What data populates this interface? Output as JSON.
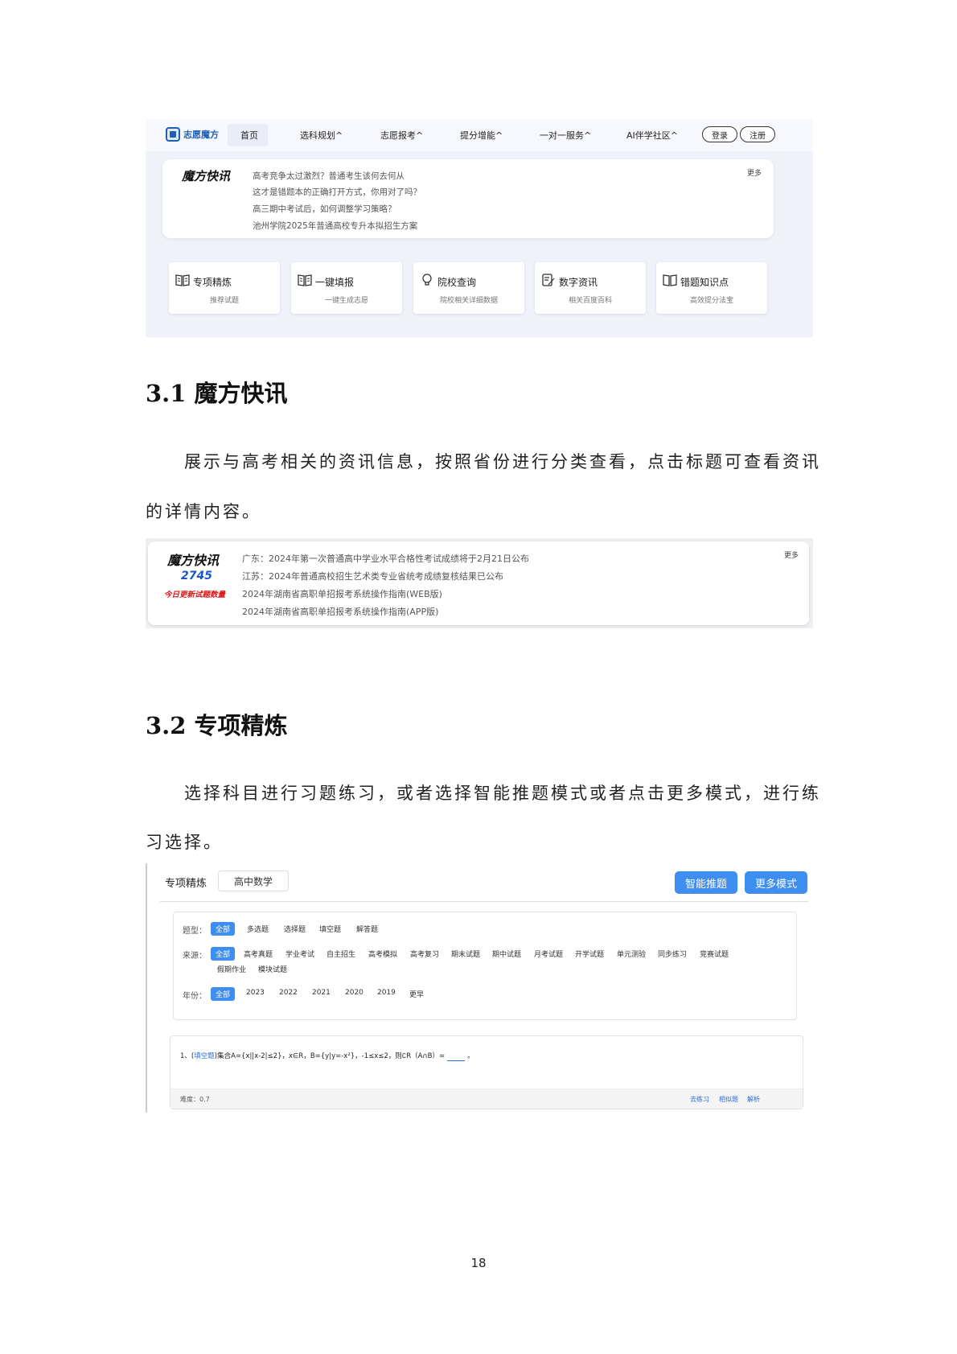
{
  "shot1": {
    "logo_text": "志愿魔方",
    "nav": [
      "首页",
      "选科规划",
      "志愿报考",
      "提分增能",
      "一对一服务",
      "AI伴学社区"
    ],
    "login": "登录",
    "register": "注册",
    "news_brand": "魔方快讯",
    "more": "更多",
    "news": [
      "高考竞争太过激烈？普通考生该何去何从",
      "这才是错题本的正确打开方式，你用对了吗？",
      "高三期中考试后，如何调整学习策略？",
      "池州学院2025年普通高校专升本拟招生方案"
    ],
    "features": [
      {
        "title": "专项精炼",
        "sub": "推荐试题"
      },
      {
        "title": "一键填报",
        "sub": "一键生成志愿"
      },
      {
        "title": "院校查询",
        "sub": "院校相关详细数据"
      },
      {
        "title": "数字资讯",
        "sub": "相关百度百科"
      },
      {
        "title": "错题知识点",
        "sub": "高效提分法宝"
      }
    ]
  },
  "section1": {
    "heading": "3.1  魔方快讯",
    "para_line1": "展示与高考相关的资讯信息，按照省份进行分类查看，点击标题可查看资讯",
    "para_line2": "的详情内容。"
  },
  "shot2": {
    "brand": "魔方快讯",
    "count": "2745",
    "count_label": "今日更新试题数量",
    "more": "更多",
    "news": [
      "广东：2024年第一次普通高中学业水平合格性考试成绩将于2月21日公布",
      "江苏：2024年普通高校招生艺术类专业省统考成绩复核结果已公布",
      "2024年湖南省高职单招报考系统操作指南(WEB版)",
      "2024年湖南省高职单招报考系统操作指南(APP版)"
    ]
  },
  "section2": {
    "heading": "3.2 专项精炼",
    "para_line1": "选择科目进行习题练习，或者选择智能推题模式或者点击更多模式，进行练",
    "para_line2": "习选择。"
  },
  "shot3": {
    "title": "专项精炼",
    "subject": "高中数学",
    "btn_smart": "智能推题",
    "btn_more": "更多模式",
    "type_label": "题型：",
    "types": [
      "全部",
      "多选题",
      "选择题",
      "填空题",
      "解答题"
    ],
    "source_label": "来源：",
    "sources_row1": [
      "全部",
      "高考真题",
      "学业考试",
      "自主招生",
      "高考模拟",
      "高考复习",
      "期末试题",
      "期中试题",
      "月考试题",
      "开学试题",
      "单元测验",
      "同步练习",
      "竞赛试题"
    ],
    "sources_row2": [
      "假期作业",
      "模块试题"
    ],
    "year_label": "年份：",
    "years": [
      "全部",
      "2023",
      "2022",
      "2021",
      "2020",
      "2019",
      "更早"
    ],
    "question_prefix": "1、(",
    "question_type": "填空题",
    "question_text": ")集合A={x||x-2|≤2}，x∈R，B={y|y=-x²}，-1≤x≤2，则∁R（A∩B）=",
    "question_end": "。",
    "difficulty": "难度：0.7",
    "actions": [
      "去练习",
      "相似题",
      "解析"
    ]
  },
  "page_number": "18"
}
